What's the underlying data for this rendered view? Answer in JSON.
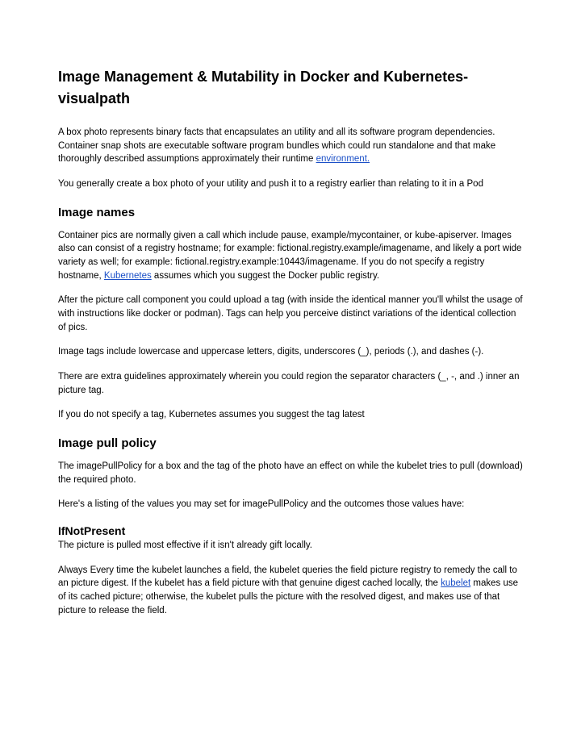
{
  "title": "Image Management & Mutability in Docker and Kubernetes- visualpath",
  "intro": {
    "p1_a": "A box photo represents binary facts that encapsulates an utility and all its software program dependencies. Container snap shots are executable software program bundles which could run standalone and that make thoroughly described assumptions approximately their runtime ",
    "p1_link": "environment.",
    "p2": "You generally create a box photo of your utility and push it to a registry earlier than relating to it in a Pod"
  },
  "image_names": {
    "heading": "Image names",
    "p1_a": "Container pics are normally given a call which include pause, example/mycontainer, or kube-apiserver. Images also can consist of a registry hostname; for example: fictional.registry.example/imagename, and likely a port wide variety as well; for example: fictional.registry.example:10443/imagename. If you do not specify a registry hostname, ",
    "p1_link": "Kubernetes",
    "p1_b": " assumes which you suggest the Docker public registry.",
    "p2": "After the picture call component you could upload a tag (with inside the identical manner you'll whilst the usage of with instructions like docker or podman). Tags can help you perceive distinct variations of the identical collection of pics.",
    "p3": "Image tags include lowercase and uppercase letters, digits, underscores (_), periods (.), and dashes (-).",
    "p4": " There are extra guidelines approximately wherein you could region the separator characters (_, -, and .) inner an picture tag.",
    "p5": "If you do not specify a tag, Kubernetes assumes you suggest the tag latest"
  },
  "pull_policy": {
    "heading": "Image pull policy",
    "p1": "The imagePullPolicy for a box and the tag of the photo have an effect on while the kubelet tries to pull (download) the required photo.",
    "p2": "Here's a listing of the values you may set for imagePullPolicy and the outcomes those values have:"
  },
  "ifnotpresent": {
    "heading": "IfNotPresent",
    "p1": "The picture is pulled most effective if it isn't already gift locally.",
    "p2_a": "Always Every time the kubelet launches a field, the kubelet queries the field picture registry to remedy the call to an picture digest. If the kubelet has a field picture with that genuine digest cached locally, the ",
    "p2_link": "kubelet",
    "p2_b": " makes use of its cached picture; otherwise, the kubelet pulls the picture with the resolved digest, and makes use of that picture to release the field."
  }
}
